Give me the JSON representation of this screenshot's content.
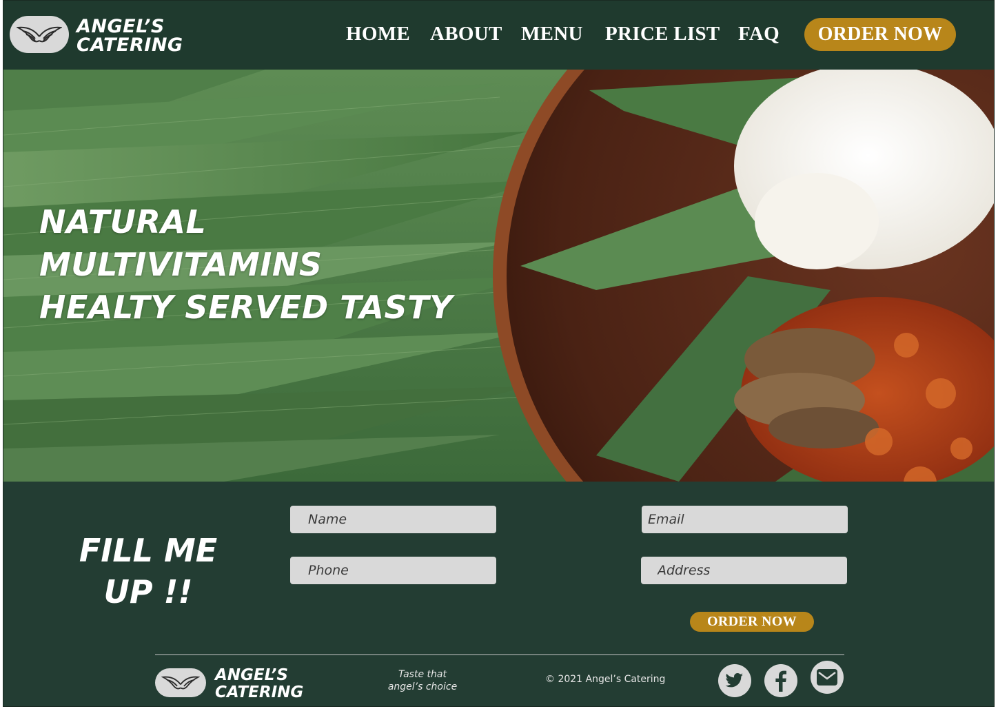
{
  "brand": {
    "line1": "ANGEL’S",
    "line2": "CATERING"
  },
  "nav": {
    "home": "HOME",
    "about": "ABOUT",
    "menu": "MENU",
    "price_list": "PRICE LIST",
    "faq": "FAQ",
    "order_now": "ORDER NOW"
  },
  "hero": {
    "line1": "NATURAL",
    "line2": "MULTIVITAMINS",
    "line3": "HEALTY SERVED TASTY"
  },
  "form": {
    "title_line1": "FILL ME",
    "title_line2": "UP !!",
    "name_placeholder": "Name",
    "email_placeholder": "Email",
    "phone_placeholder": "Phone",
    "address_placeholder": "Address",
    "submit_label": "ORDER NOW"
  },
  "footer": {
    "brand_line1": "ANGEL’S",
    "brand_line2": "CATERING",
    "tagline_line1": "Taste that",
    "tagline_line2": "angel’s choice",
    "copyright": "© 2021 Angel’s Catering",
    "social": [
      "twitter-icon",
      "facebook-icon",
      "email-icon"
    ]
  },
  "colors": {
    "header_bg": "#1f3a2e",
    "section_bg": "#233d33",
    "accent": "#b8861a",
    "field_bg": "#d9d9d9"
  }
}
